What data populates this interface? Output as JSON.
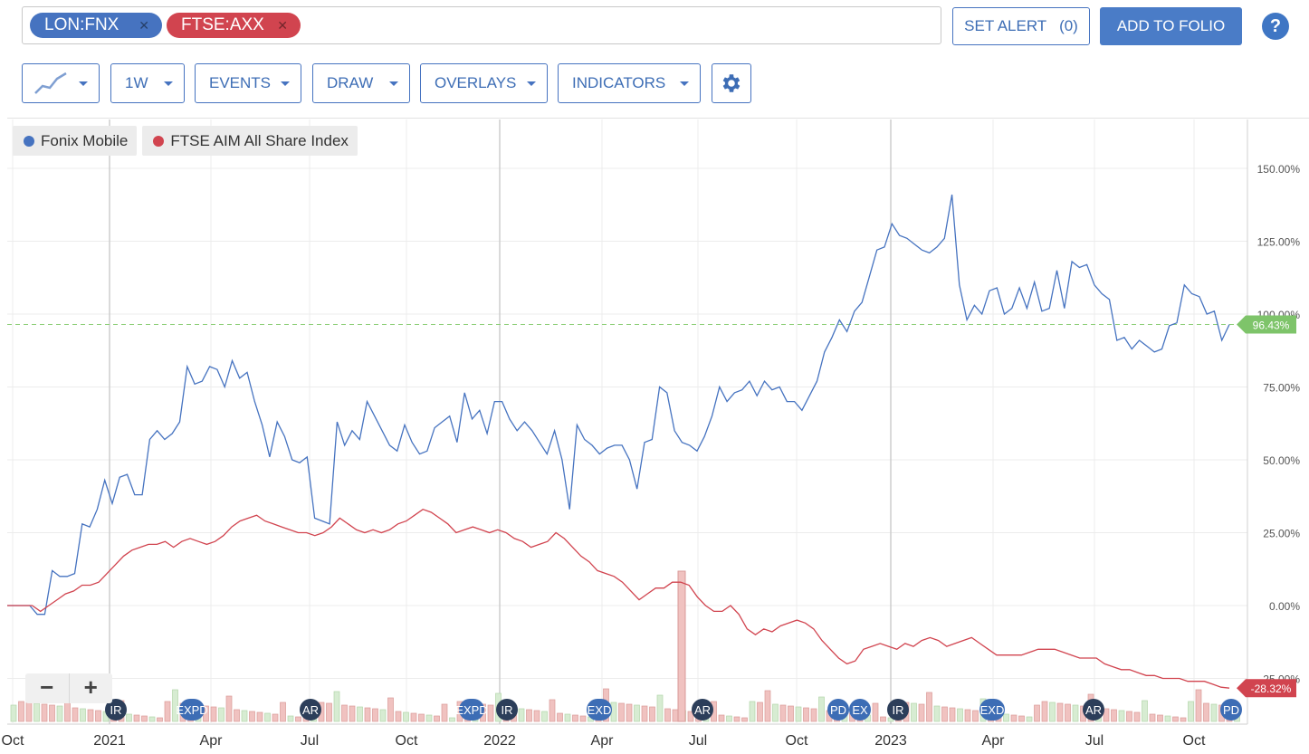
{
  "symbols": [
    {
      "ticker": "LON:FNX",
      "color": "#4673c0"
    },
    {
      "ticker": "FTSE:AXX",
      "color": "#d1444f"
    }
  ],
  "header": {
    "set_alert_label": "SET ALERT",
    "alert_count": "(0)",
    "add_to_folio_label": "ADD TO FOLIO",
    "help_label": "?"
  },
  "toolbar": {
    "chart_type_icon": "line-chart-icon",
    "interval_label": "1W",
    "events_label": "EVENTS",
    "draw_label": "DRAW",
    "overlays_label": "OVERLAYS",
    "indicators_label": "INDICATORS",
    "settings_icon": "gear-icon"
  },
  "zoom": {
    "minus": "−",
    "plus": "+"
  },
  "legend": [
    {
      "name": "Fonix Mobile",
      "color": "#4673c0"
    },
    {
      "name": "FTSE AIM All Share Index",
      "color": "#d1444f"
    }
  ],
  "chart_data": {
    "type": "line",
    "y_unit": "%",
    "yticks": [
      "150.00%",
      "125.00%",
      "100.00%",
      "75.00%",
      "50.00%",
      "25.00%",
      "0.00%",
      "-25.00%"
    ],
    "x_ticks": [
      "Oct",
      "2021",
      "Apr",
      "Jul",
      "Oct",
      "2022",
      "Apr",
      "Jul",
      "Oct",
      "2023",
      "Apr",
      "Jul",
      "Oct"
    ],
    "series": [
      {
        "name": "Fonix Mobile",
        "color": "#4673c0",
        "last_label": "96.43%",
        "last_value": 96.43,
        "values": [
          0,
          0,
          0,
          0,
          -3,
          -3,
          12,
          10,
          10,
          11,
          28,
          27,
          33,
          43,
          35,
          44,
          45,
          38,
          38,
          57,
          60,
          57,
          59,
          63,
          82,
          76,
          77,
          82,
          81,
          75,
          84,
          78,
          80,
          70,
          62,
          51,
          63,
          58,
          50,
          49,
          51,
          30,
          29,
          28,
          63,
          55,
          60,
          57,
          70,
          65,
          60,
          55,
          53,
          62,
          56,
          52,
          53,
          61,
          63,
          65,
          56,
          73,
          64,
          67,
          59,
          70,
          70,
          64,
          60,
          63,
          60,
          56,
          52,
          60,
          50,
          33,
          62,
          57,
          55,
          52,
          54,
          55,
          55,
          50,
          40,
          56,
          57,
          75,
          73,
          60,
          56,
          55,
          53,
          58,
          65,
          75,
          70,
          73,
          74,
          77,
          72,
          77,
          74,
          75,
          70,
          70,
          67,
          72,
          77,
          87,
          92,
          98,
          94,
          101,
          104,
          113,
          122,
          123,
          131,
          127,
          126,
          124,
          122,
          121,
          123,
          126,
          141,
          110,
          98,
          103,
          100,
          108,
          109,
          100,
          102,
          109,
          102,
          111,
          101,
          102,
          115,
          102,
          118,
          116,
          117,
          110,
          107,
          105,
          91,
          92,
          88,
          91,
          89,
          87,
          88,
          96,
          97,
          110,
          107,
          106,
          100,
          101,
          91,
          96.43
        ]
      },
      {
        "name": "FTSE AIM All Share Index",
        "color": "#d1444f",
        "last_label": "-28.32%",
        "last_value": -28.32,
        "values": [
          0,
          0,
          0,
          0,
          -2,
          0,
          2,
          4,
          5,
          7,
          7,
          8,
          11,
          14,
          17,
          19,
          20,
          21,
          21,
          22,
          20,
          22,
          23,
          22,
          21,
          22,
          24,
          27,
          29,
          30,
          31,
          29,
          28,
          27,
          26,
          25,
          25,
          24,
          25,
          27,
          30,
          28,
          26,
          25,
          26,
          25,
          26,
          28,
          29,
          31,
          33,
          32,
          30,
          28,
          25,
          26,
          27,
          26,
          25,
          26,
          25,
          23,
          22,
          20,
          21,
          22,
          25,
          23,
          20,
          17,
          15,
          12,
          11,
          10,
          8,
          5,
          2,
          4,
          6,
          6,
          8,
          8,
          7,
          3,
          0,
          -2,
          -2,
          0,
          -3,
          -8,
          -10,
          -8,
          -9,
          -7,
          -6,
          -5,
          -6,
          -8,
          -12,
          -15,
          -18,
          -20,
          -19,
          -15,
          -14,
          -13,
          -14,
          -15,
          -13,
          -14,
          -12,
          -11,
          -12,
          -14,
          -13,
          -12,
          -11,
          -13,
          -15,
          -17,
          -17,
          -17,
          -17,
          -16,
          -15,
          -15,
          -15,
          -16,
          -17,
          -18,
          -18,
          -18,
          -20,
          -21,
          -22,
          -22,
          -23,
          -24,
          -24,
          -25,
          -25,
          -25,
          -26,
          -26,
          -26,
          -27,
          -28,
          -28.32
        ]
      }
    ],
    "reference_line": 96.43,
    "event_markers": [
      {
        "label": "IR",
        "color": "#2c3e5a"
      },
      {
        "label": "EXPD",
        "color": "#3d6db5"
      },
      {
        "label": "AR",
        "color": "#2c3e5a"
      },
      {
        "label": "EXPD",
        "color": "#3d6db5"
      },
      {
        "label": "IR",
        "color": "#2c3e5a"
      },
      {
        "label": "EXD",
        "color": "#3d6db5"
      },
      {
        "label": "AR",
        "color": "#2c3e5a"
      },
      {
        "label": "PD",
        "color": "#3d6db5"
      },
      {
        "label": "EX",
        "color": "#3d6db5"
      },
      {
        "label": "IR",
        "color": "#2c3e5a"
      },
      {
        "label": "EXD",
        "color": "#3d6db5"
      },
      {
        "label": "AR",
        "color": "#2c3e5a"
      },
      {
        "label": "PD",
        "color": "#3d6db5"
      }
    ]
  }
}
